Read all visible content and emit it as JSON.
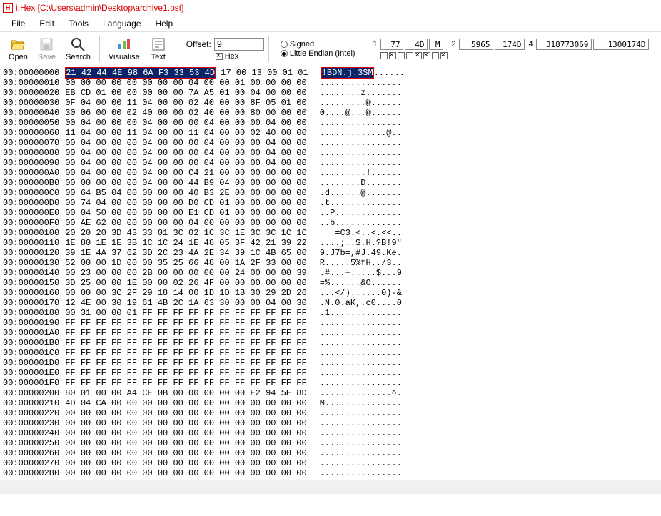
{
  "window": {
    "app_icon_letter": "H",
    "title": "i.Hex [C:\\Users\\admin\\Desktop\\archive1.ost]"
  },
  "menu": [
    "File",
    "Edit",
    "Tools",
    "Language",
    "Help"
  ],
  "toolbar": {
    "open": "Open",
    "save": "Save",
    "search": "Search",
    "visualise": "Visualise",
    "text": "Text"
  },
  "offset": {
    "label": "Offset:",
    "value": "9",
    "hex_label": "Hex"
  },
  "flags": {
    "signed": "Signed",
    "endian": "Little Endian (Intel)"
  },
  "vals": {
    "n1": "1",
    "v1a": "77",
    "v1b": "4D",
    "v1c": "M",
    "n2": "2",
    "v2a": "5965",
    "v2b": "174D",
    "n4": "4",
    "v4a": "318773069",
    "v4b": "1300174D"
  },
  "hex": {
    "sel_hex_prefix": "21 42 44 4E 98 6A F3 33 53 4D",
    "sel_hex_suffix": " 17 00 13 00 01 01",
    "sel_ascii_prefix": "!BDN.j.3SM",
    "sel_ascii_suffix": "......",
    "rows": [
      {
        "o": "00:00000010",
        "h": "00 00 00 00 00 00 00 00 04 00 00 01 00 00 00 00",
        "a": "................"
      },
      {
        "o": "00:00000020",
        "h": "EB CD 01 00 00 00 00 00 7A A5 01 00 04 00 00 00",
        "a": "........z......."
      },
      {
        "o": "00:00000030",
        "h": "0F 04 00 00 11 04 00 00 02 40 00 00 8F 05 01 00",
        "a": ".........@......"
      },
      {
        "o": "00:00000040",
        "h": "30 06 00 00 02 40 00 00 02 40 00 00 80 00 00 00",
        "a": "0....@...@......"
      },
      {
        "o": "00:00000050",
        "h": "00 04 00 00 00 04 00 00 00 04 00 00 00 04 00 00",
        "a": "................"
      },
      {
        "o": "00:00000060",
        "h": "11 04 00 00 11 04 00 00 11 04 00 00 02 40 00 00",
        "a": ".............@.."
      },
      {
        "o": "00:00000070",
        "h": "00 04 00 00 00 04 00 00 00 04 00 00 00 04 00 00",
        "a": "................"
      },
      {
        "o": "00:00000080",
        "h": "00 04 00 00 00 04 00 00 00 04 00 00 00 04 00 00",
        "a": "................"
      },
      {
        "o": "00:00000090",
        "h": "00 04 00 00 00 04 00 00 00 04 00 00 00 04 00 00",
        "a": "................"
      },
      {
        "o": "00:000000A0",
        "h": "00 04 00 00 00 04 00 00 C4 21 00 00 00 00 00 00",
        "a": ".........!......"
      },
      {
        "o": "00:000000B0",
        "h": "00 00 00 00 00 04 00 00 44 B9 04 00 00 00 00 00",
        "a": "........D......."
      },
      {
        "o": "00:000000C0",
        "h": "00 64 B5 04 00 00 00 00 40 B3 2E 00 00 00 00 00",
        "a": ".d......@......."
      },
      {
        "o": "00:000000D0",
        "h": "00 74 04 00 00 00 00 00 D0 CD 01 00 00 00 00 00",
        "a": ".t.............."
      },
      {
        "o": "00:000000E0",
        "h": "00 04 50 00 00 00 00 00 E1 CD 01 00 00 00 00 00",
        "a": "..P............."
      },
      {
        "o": "00:000000F0",
        "h": "00 AE 62 00 00 00 00 00 04 00 00 00 00 00 00 00",
        "a": "..b............."
      },
      {
        "o": "00:00000100",
        "h": "20 20 20 3D 43 33 01 3C 02 1C 3C 1E 3C 3C 1C 1C",
        "a": "   =C3.<..<.<<.."
      },
      {
        "o": "00:00000110",
        "h": "1E 80 1E 1E 3B 1C 1C 24 1E 48 05 3F 42 21 39 22",
        "a": "....;..$.H.?B!9\""
      },
      {
        "o": "00:00000120",
        "h": "39 1E 4A 37 62 3D 2C 23 4A 2E 34 39 1C 4B 65 00",
        "a": "9.J7b=,#J.49.Ke."
      },
      {
        "o": "00:00000130",
        "h": "52 00 00 1D 00 00 35 25 66 48 00 1A 2F 33 00 00",
        "a": "R.....5%fH../3.."
      },
      {
        "o": "00:00000140",
        "h": "00 23 00 00 00 2B 00 00 00 00 00 24 00 00 00 39",
        "a": ".#...+.....$...9"
      },
      {
        "o": "00:00000150",
        "h": "3D 25 00 00 1E 00 00 02 26 4F 00 00 00 00 00 00",
        "a": "=%......&O......"
      },
      {
        "o": "00:00000160",
        "h": "00 00 00 3C 2F 29 18 14 00 1D 1D 1B 30 29 2D 26",
        "a": "...</)......0)-&"
      },
      {
        "o": "00:00000170",
        "h": "12 4E 00 30 19 61 4B 2C 1A 63 30 00 00 04 00 30",
        "a": ".N.0.aK,.c0....0"
      },
      {
        "o": "00:00000180",
        "h": "00 31 00 00 01 FF FF FF FF FF FF FF FF FF FF FF",
        "a": ".1.............."
      },
      {
        "o": "00:00000190",
        "h": "FF FF FF FF FF FF FF FF FF FF FF FF FF FF FF FF",
        "a": "................"
      },
      {
        "o": "00:000001A0",
        "h": "FF FF FF FF FF FF FF FF FF FF FF FF FF FF FF FF",
        "a": "................"
      },
      {
        "o": "00:000001B0",
        "h": "FF FF FF FF FF FF FF FF FF FF FF FF FF FF FF FF",
        "a": "................"
      },
      {
        "o": "00:000001C0",
        "h": "FF FF FF FF FF FF FF FF FF FF FF FF FF FF FF FF",
        "a": "................"
      },
      {
        "o": "00:000001D0",
        "h": "FF FF FF FF FF FF FF FF FF FF FF FF FF FF FF FF",
        "a": "................"
      },
      {
        "o": "00:000001E0",
        "h": "FF FF FF FF FF FF FF FF FF FF FF FF FF FF FF FF",
        "a": "................"
      },
      {
        "o": "00:000001F0",
        "h": "FF FF FF FF FF FF FF FF FF FF FF FF FF FF FF FF",
        "a": "................"
      },
      {
        "o": "00:00000200",
        "h": "80 01 00 00 A4 CE 0B 00 00 00 00 00 E2 94 5E 8D",
        "a": "..............^."
      },
      {
        "o": "00:00000210",
        "h": "4D 04 CA 00 00 00 00 00 00 00 00 00 00 00 00 00",
        "a": "M..............."
      },
      {
        "o": "00:00000220",
        "h": "00 00 00 00 00 00 00 00 00 00 00 00 00 00 00 00",
        "a": "................"
      },
      {
        "o": "00:00000230",
        "h": "00 00 00 00 00 00 00 00 00 00 00 00 00 00 00 00",
        "a": "................"
      },
      {
        "o": "00:00000240",
        "h": "00 00 00 00 00 00 00 00 00 00 00 00 00 00 00 00",
        "a": "................"
      },
      {
        "o": "00:00000250",
        "h": "00 00 00 00 00 00 00 00 00 00 00 00 00 00 00 00",
        "a": "................"
      },
      {
        "o": "00:00000260",
        "h": "00 00 00 00 00 00 00 00 00 00 00 00 00 00 00 00",
        "a": "................"
      },
      {
        "o": "00:00000270",
        "h": "00 00 00 00 00 00 00 00 00 00 00 00 00 00 00 00",
        "a": "................"
      },
      {
        "o": "00:00000280",
        "h": "00 00 00 00 00 00 00 00 00 00 00 00 00 00 00 00",
        "a": "................"
      }
    ]
  }
}
